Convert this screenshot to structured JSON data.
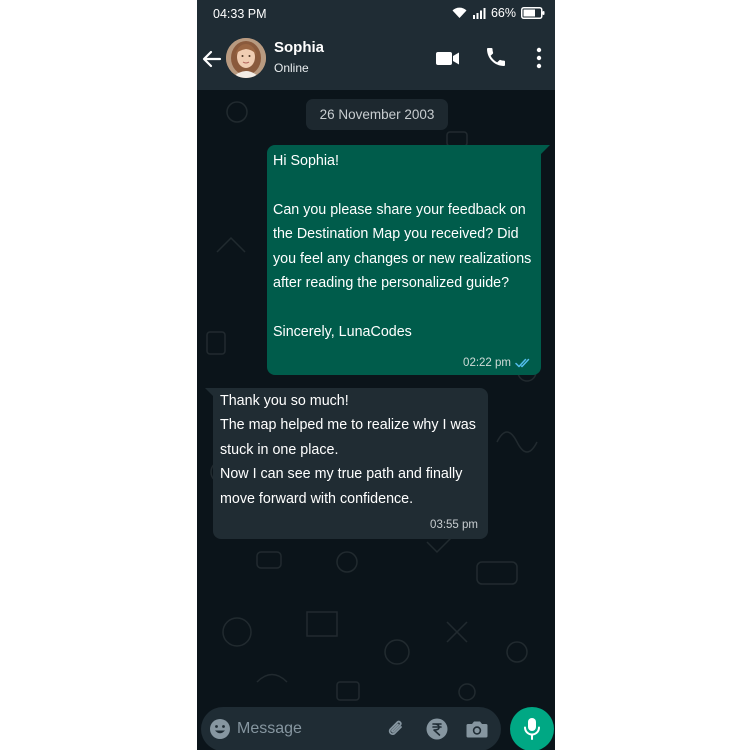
{
  "status_bar": {
    "time": "04:33 PM",
    "battery": "66%"
  },
  "header": {
    "name": "Sophia",
    "status": "Online"
  },
  "chat": {
    "date": "26 November 2003",
    "messages": [
      {
        "direction": "outgoing",
        "text": "Hi Sophia!\n\nCan you please share your feedback on the Destination Map you received? Did you feel any changes or new realizations after reading the personalized guide?\n\nSincerely, LunaCodes",
        "time": "02:22 pm",
        "read": true
      },
      {
        "direction": "incoming",
        "text": " Thank you so much!\nThe map helped me to realize why I was stuck in one place.\nNow I can see my true path and finally move forward with confidence.",
        "time": "03:55 pm"
      }
    ]
  },
  "input": {
    "placeholder": "Message"
  },
  "colors": {
    "outgoing_bubble": "#005c4b",
    "incoming_bubble": "#202c33",
    "accent": "#00a884",
    "read_ticks": "#53bdeb"
  }
}
